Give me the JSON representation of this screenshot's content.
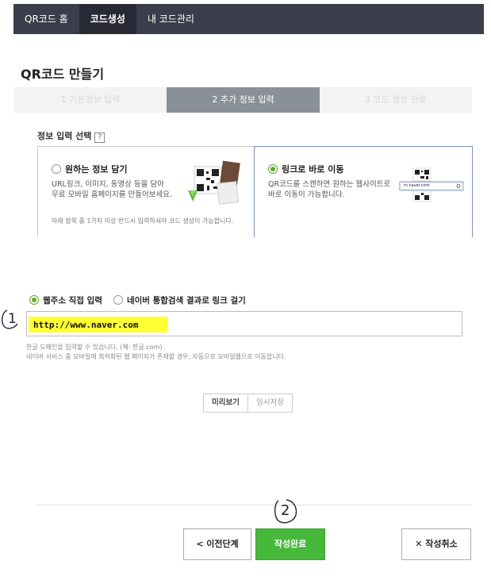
{
  "nav": {
    "tabs": [
      {
        "label": "QR코드 홈"
      },
      {
        "label": "코드생성"
      },
      {
        "label": "내 코드관리"
      }
    ],
    "active": 1
  },
  "page_title": "QR코드 만들기",
  "steps": [
    {
      "label": "1 기본정보 입력"
    },
    {
      "label": "2 추가 정보 입력"
    },
    {
      "label": "3 코드 생성 완료"
    }
  ],
  "info_section": {
    "label": "정보 입력 선택",
    "help": "?",
    "option_left": {
      "title": "원하는 정보 담기",
      "desc_line1": "URL링크, 이미지, 동영상 등을 담아",
      "desc_line2": "무료 모바일 홈페이지를 만들어보세요.",
      "note": "아래 항목 중 1가지 이상 반드시 입력하셔야 코드 생성이 가능합니다."
    },
    "option_right": {
      "title": "링크로 바로 이동",
      "desc_line1": "QR코드를 스캔하면 원하는 웹사이트로",
      "desc_line2": "바로 이동이 가능합니다.",
      "thumb_text": "m.naver.com"
    }
  },
  "link_type": {
    "option1": "웹주소 직접 입력",
    "option2": "네이버 통합검색 결과로 링크 걸기"
  },
  "url_input": {
    "value": "http://www.naver.com"
  },
  "hints": {
    "line1": "한글 도메인을 입력할 수 있습니다. (예: 한글.com)",
    "line2": "네이버 서비스 중 모바일에 최적화된 웹 페이지가 존재할 경우, 자동으로 모바일웹으로 이동합니다."
  },
  "mini_buttons": {
    "preview": "미리보기",
    "temp_save": "임시저장"
  },
  "annotations": {
    "one": "1",
    "two": "2"
  },
  "footer_buttons": {
    "prev": "< 이전단계",
    "done": "작성완료",
    "cancel": "✕ 작성취소"
  },
  "colors": {
    "accent_green": "#46b93a",
    "nav_bg": "#3a3d4a",
    "highlight": "#ffff33"
  }
}
